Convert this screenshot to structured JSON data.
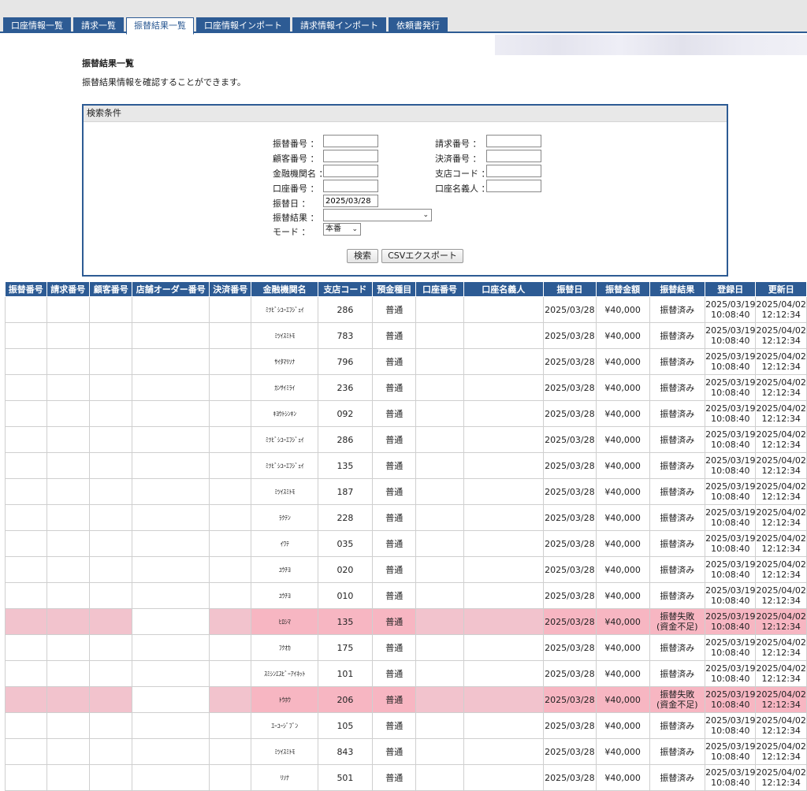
{
  "tabs": [
    {
      "label": "口座情報一覧",
      "active": false
    },
    {
      "label": "請求一覧",
      "active": false
    },
    {
      "label": "振替結果一覧",
      "active": true
    },
    {
      "label": "口座情報インポート",
      "active": false
    },
    {
      "label": "請求情報インポート",
      "active": false
    },
    {
      "label": "依頼書発行",
      "active": false
    }
  ],
  "page": {
    "title": "振替結果一覧",
    "description": "振替結果情報を確認することができます。"
  },
  "search": {
    "header": "検索条件",
    "fields": {
      "transfer_no": {
        "label": "振替番号 ：",
        "value": ""
      },
      "customer_no": {
        "label": "顧客番号 ：",
        "value": ""
      },
      "bank_name": {
        "label": "金融機関名 ：",
        "value": ""
      },
      "account_no": {
        "label": "口座番号 ：",
        "value": ""
      },
      "transfer_date": {
        "label": "振替日 ：",
        "value": "2025/03/28"
      },
      "transfer_result": {
        "label": "振替結果 ：",
        "value": ""
      },
      "mode": {
        "label": "モード ：",
        "value": "本番"
      },
      "invoice_no": {
        "label": "請求番号 ：",
        "value": ""
      },
      "settlement_no": {
        "label": "決済番号 ：",
        "value": ""
      },
      "branch_code": {
        "label": "支店コード ：",
        "value": ""
      },
      "account_holder": {
        "label": "口座名義人 ：",
        "value": ""
      }
    },
    "search_button": "検索",
    "csv_button": "CSVエクスポート"
  },
  "table": {
    "columns": [
      "振替番号",
      "請求番号",
      "顧客番号",
      "店舗オーダー番号",
      "決済番号",
      "金融機関名",
      "支店コード",
      "預金種目",
      "口座番号",
      "口座名義人",
      "振替日",
      "振替金額",
      "振替結果",
      "登録日",
      "更新日"
    ],
    "rows": [
      {
        "bank": "ﾐﾂﾋﾞｼﾕｰｴﾌｼﾞｪｲ",
        "branch": "286",
        "type": "普通",
        "date": "2025/03/28",
        "amount": "¥40,000",
        "result": "振替済み",
        "result2": "",
        "reg_date": "2025/03/19",
        "reg_time": "10:08:40",
        "upd_date": "2025/04/02",
        "upd_time": "12:12:34",
        "fail": false
      },
      {
        "bank": "ﾐﾂｲｽﾐﾄﾓ",
        "branch": "783",
        "type": "普通",
        "date": "2025/03/28",
        "amount": "¥40,000",
        "result": "振替済み",
        "result2": "",
        "reg_date": "2025/03/19",
        "reg_time": "10:08:40",
        "upd_date": "2025/04/02",
        "upd_time": "12:12:34",
        "fail": false
      },
      {
        "bank": "ｻｲﾀﾏﾘｿﾅ",
        "branch": "796",
        "type": "普通",
        "date": "2025/03/28",
        "amount": "¥40,000",
        "result": "振替済み",
        "result2": "",
        "reg_date": "2025/03/19",
        "reg_time": "10:08:40",
        "upd_date": "2025/04/02",
        "upd_time": "12:12:34",
        "fail": false
      },
      {
        "bank": "ｶﾝｻｲﾐﾗｲ",
        "branch": "236",
        "type": "普通",
        "date": "2025/03/28",
        "amount": "¥40,000",
        "result": "振替済み",
        "result2": "",
        "reg_date": "2025/03/19",
        "reg_time": "10:08:40",
        "upd_date": "2025/04/02",
        "upd_time": "12:12:34",
        "fail": false
      },
      {
        "bank": "ｷﾖｳﾄｼﾝｷﾝ",
        "branch": "092",
        "type": "普通",
        "date": "2025/03/28",
        "amount": "¥40,000",
        "result": "振替済み",
        "result2": "",
        "reg_date": "2025/03/19",
        "reg_time": "10:08:40",
        "upd_date": "2025/04/02",
        "upd_time": "12:12:34",
        "fail": false
      },
      {
        "bank": "ﾐﾂﾋﾞｼﾕｰｴﾌｼﾞｪｲ",
        "branch": "286",
        "type": "普通",
        "date": "2025/03/28",
        "amount": "¥40,000",
        "result": "振替済み",
        "result2": "",
        "reg_date": "2025/03/19",
        "reg_time": "10:08:40",
        "upd_date": "2025/04/02",
        "upd_time": "12:12:34",
        "fail": false
      },
      {
        "bank": "ﾐﾂﾋﾞｼﾕｰｴﾌｼﾞｪｲ",
        "branch": "135",
        "type": "普通",
        "date": "2025/03/28",
        "amount": "¥40,000",
        "result": "振替済み",
        "result2": "",
        "reg_date": "2025/03/19",
        "reg_time": "10:08:40",
        "upd_date": "2025/04/02",
        "upd_time": "12:12:34",
        "fail": false
      },
      {
        "bank": "ﾐﾂｲｽﾐﾄﾓ",
        "branch": "187",
        "type": "普通",
        "date": "2025/03/28",
        "amount": "¥40,000",
        "result": "振替済み",
        "result2": "",
        "reg_date": "2025/03/19",
        "reg_time": "10:08:40",
        "upd_date": "2025/04/02",
        "upd_time": "12:12:34",
        "fail": false
      },
      {
        "bank": "ﾗｸﾃﾝ",
        "branch": "228",
        "type": "普通",
        "date": "2025/03/28",
        "amount": "¥40,000",
        "result": "振替済み",
        "result2": "",
        "reg_date": "2025/03/19",
        "reg_time": "10:08:40",
        "upd_date": "2025/04/02",
        "upd_time": "12:12:34",
        "fail": false
      },
      {
        "bank": "ｲﾜﾃ",
        "branch": "035",
        "type": "普通",
        "date": "2025/03/28",
        "amount": "¥40,000",
        "result": "振替済み",
        "result2": "",
        "reg_date": "2025/03/19",
        "reg_time": "10:08:40",
        "upd_date": "2025/04/02",
        "upd_time": "12:12:34",
        "fail": false
      },
      {
        "bank": "ﾕｳﾁﾖ",
        "branch": "020",
        "type": "普通",
        "date": "2025/03/28",
        "amount": "¥40,000",
        "result": "振替済み",
        "result2": "",
        "reg_date": "2025/03/19",
        "reg_time": "10:08:40",
        "upd_date": "2025/04/02",
        "upd_time": "12:12:34",
        "fail": false
      },
      {
        "bank": "ﾕｳﾁﾖ",
        "branch": "010",
        "type": "普通",
        "date": "2025/03/28",
        "amount": "¥40,000",
        "result": "振替済み",
        "result2": "",
        "reg_date": "2025/03/19",
        "reg_time": "10:08:40",
        "upd_date": "2025/04/02",
        "upd_time": "12:12:34",
        "fail": false
      },
      {
        "bank": "ﾋﾛｼﾏ",
        "branch": "135",
        "type": "普通",
        "date": "2025/03/28",
        "amount": "¥40,000",
        "result": "振替失敗",
        "result2": "(資金不足)",
        "reg_date": "2025/03/19",
        "reg_time": "10:08:40",
        "upd_date": "2025/04/02",
        "upd_time": "12:12:34",
        "fail": true
      },
      {
        "bank": "ﾌｸｵｶ",
        "branch": "175",
        "type": "普通",
        "date": "2025/03/28",
        "amount": "¥40,000",
        "result": "振替済み",
        "result2": "",
        "reg_date": "2025/03/19",
        "reg_time": "10:08:40",
        "upd_date": "2025/04/02",
        "upd_time": "12:12:34",
        "fail": false
      },
      {
        "bank": "ｽﾐｼﾝｴｽﾋﾞｰｱｲﾈｯﾄ",
        "branch": "101",
        "type": "普通",
        "date": "2025/03/28",
        "amount": "¥40,000",
        "result": "振替済み",
        "result2": "",
        "reg_date": "2025/03/19",
        "reg_time": "10:08:40",
        "upd_date": "2025/04/02",
        "upd_time": "12:12:34",
        "fail": false
      },
      {
        "bank": "ﾄｳﾎｳ",
        "branch": "206",
        "type": "普通",
        "date": "2025/03/28",
        "amount": "¥40,000",
        "result": "振替失敗",
        "result2": "(資金不足)",
        "reg_date": "2025/03/19",
        "reg_time": "10:08:40",
        "upd_date": "2025/04/02",
        "upd_time": "12:12:34",
        "fail": true
      },
      {
        "bank": "ｴｰﾕｰｼﾞﾌﾞﾝ",
        "branch": "105",
        "type": "普通",
        "date": "2025/03/28",
        "amount": "¥40,000",
        "result": "振替済み",
        "result2": "",
        "reg_date": "2025/03/19",
        "reg_time": "10:08:40",
        "upd_date": "2025/04/02",
        "upd_time": "12:12:34",
        "fail": false
      },
      {
        "bank": "ﾐﾂｲｽﾐﾄﾓ",
        "branch": "843",
        "type": "普通",
        "date": "2025/03/28",
        "amount": "¥40,000",
        "result": "振替済み",
        "result2": "",
        "reg_date": "2025/03/19",
        "reg_time": "10:08:40",
        "upd_date": "2025/04/02",
        "upd_time": "12:12:34",
        "fail": false
      },
      {
        "bank": "ﾘｿﾅ",
        "branch": "501",
        "type": "普通",
        "date": "2025/03/28",
        "amount": "¥40,000",
        "result": "振替済み",
        "result2": "",
        "reg_date": "2025/03/19",
        "reg_time": "10:08:40",
        "upd_date": "2025/04/02",
        "upd_time": "12:12:34",
        "fail": false
      }
    ]
  },
  "colors": {
    "primary": "#2d5b94",
    "fail_row": "#f7b6c2"
  }
}
